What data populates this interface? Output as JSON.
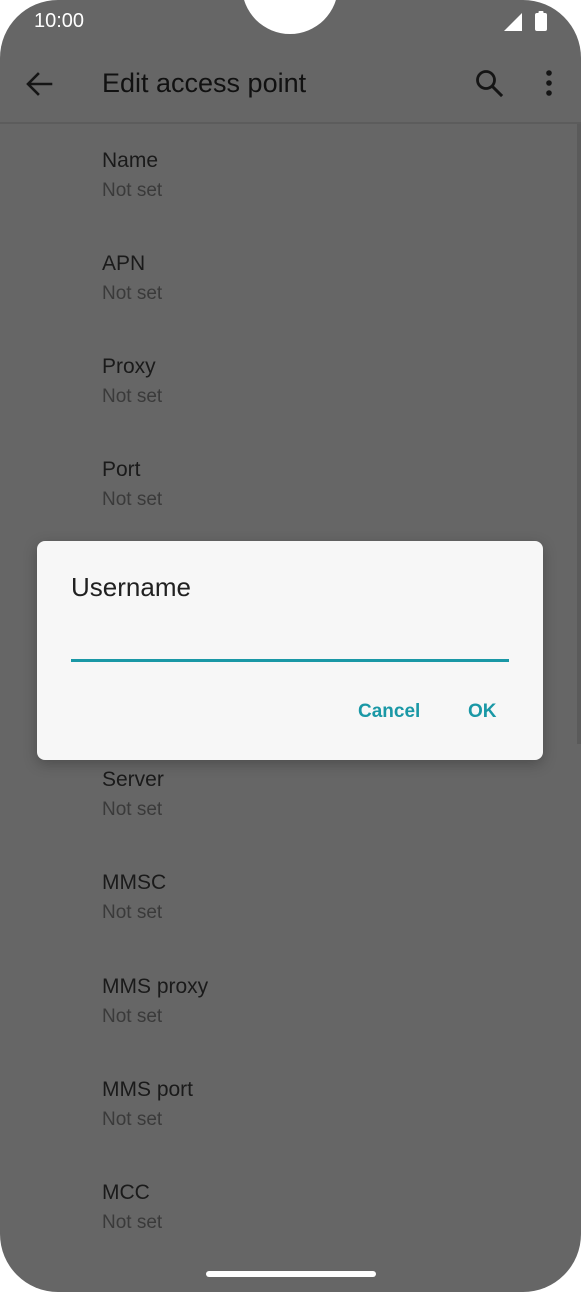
{
  "status_bar": {
    "time": "10:00",
    "signal_icon": "cellular-signal-icon",
    "battery_icon": "battery-full-icon"
  },
  "app_bar": {
    "title": "Edit access point",
    "back_icon": "arrow-back-icon",
    "search_icon": "search-icon",
    "more_icon": "more-vert-icon"
  },
  "preferences": [
    {
      "title": "Name",
      "summary": "Not set"
    },
    {
      "title": "APN",
      "summary": "Not set"
    },
    {
      "title": "Proxy",
      "summary": "Not set"
    },
    {
      "title": "Port",
      "summary": "Not set"
    },
    {
      "title": "Server",
      "summary": "Not set"
    },
    {
      "title": "MMSC",
      "summary": "Not set"
    },
    {
      "title": "MMS proxy",
      "summary": "Not set"
    },
    {
      "title": "MMS port",
      "summary": "Not set"
    },
    {
      "title": "MCC",
      "summary": "Not set"
    }
  ],
  "dialog": {
    "title": "Username",
    "input_value": "",
    "cancel_label": "Cancel",
    "ok_label": "OK"
  },
  "colors": {
    "accent": "#1a98a6",
    "scrim_background": "#666666",
    "dialog_background": "#f7f7f7"
  }
}
